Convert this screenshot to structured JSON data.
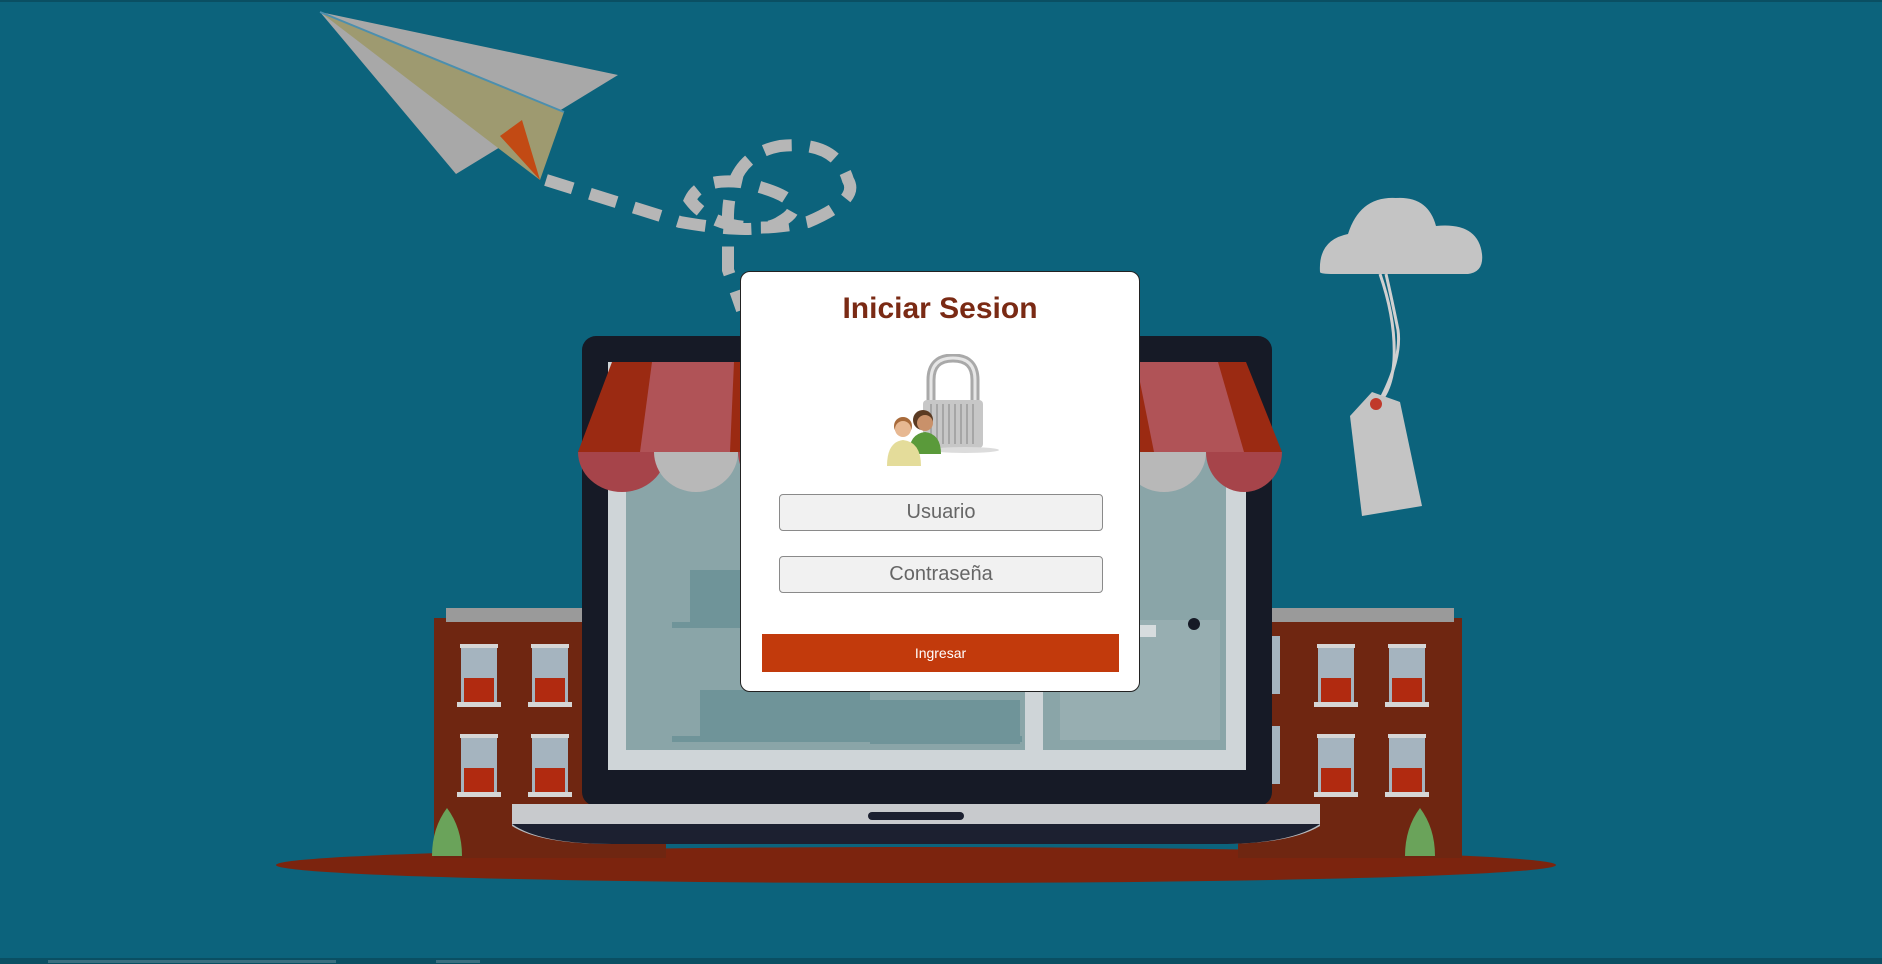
{
  "login": {
    "title": "Iniciar Sesion",
    "username_placeholder": "Usuario",
    "password_placeholder": "Contraseña",
    "submit_label": "Ingresar"
  },
  "icons": {
    "login_icon": "users-padlock-icon",
    "background": "online-store-laptop-illustration"
  },
  "colors": {
    "background": "#0c637c",
    "title": "#7a2a14",
    "button": "#c23a0c",
    "awning_red": "#9b2a12",
    "building": "#6e2410"
  }
}
